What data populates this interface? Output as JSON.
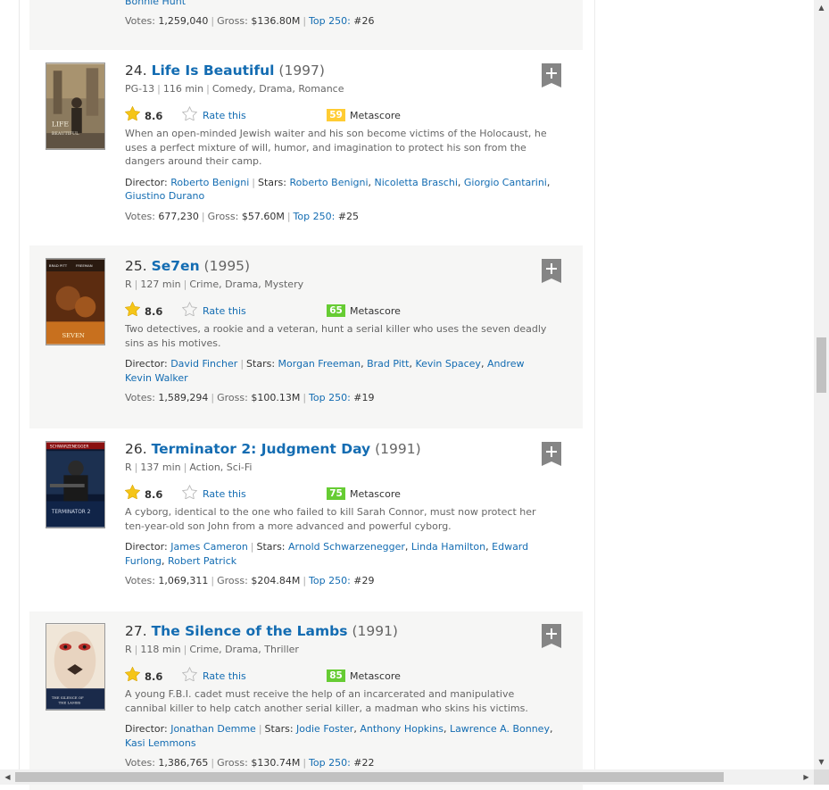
{
  "top_partial": {
    "credit_tail": "Bonnie Hunt",
    "votes_label": "Votes:",
    "votes": "1,259,040",
    "gross_label": "Gross:",
    "gross": "$136.80M",
    "top250_label": "Top 250:",
    "top250": "#26"
  },
  "movies": [
    {
      "index": "24.",
      "title": "Life Is Beautiful",
      "year": "(1997)",
      "certificate": "PG-13",
      "runtime": "116 min",
      "genres": "Comedy, Drama, Romance",
      "rating": "8.6",
      "rate_label": "Rate this",
      "metascore": "59",
      "metascore_color": "#ffcc33",
      "metascore_label": "Metascore",
      "description": "When an open-minded Jewish waiter and his son become victims of the Holocaust, he uses a perfect mixture of will, humor, and imagination to protect his son from the dangers around their camp.",
      "director_label": "Director:",
      "director": "Roberto Benigni",
      "stars_label": "Stars:",
      "stars": [
        "Roberto Benigni",
        "Nicoletta Braschi",
        "Giorgio Cantarini",
        "Giustino Durano"
      ],
      "votes_label": "Votes:",
      "votes": "677,230",
      "gross_label": "Gross:",
      "gross": "$57.60M",
      "top250_label": "Top 250:",
      "top250": "#25",
      "poster_label": "LIFE IS BEAUTIFUL"
    },
    {
      "index": "25.",
      "title": "Se7en",
      "year": "(1995)",
      "certificate": "R",
      "runtime": "127 min",
      "genres": "Crime, Drama, Mystery",
      "rating": "8.6",
      "rate_label": "Rate this",
      "metascore": "65",
      "metascore_color": "#66cc33",
      "metascore_label": "Metascore",
      "description": "Two detectives, a rookie and a veteran, hunt a serial killer who uses the seven deadly sins as his motives.",
      "director_label": "Director:",
      "director": "David Fincher",
      "stars_label": "Stars:",
      "stars": [
        "Morgan Freeman",
        "Brad Pitt",
        "Kevin Spacey",
        "Andrew Kevin Walker"
      ],
      "votes_label": "Votes:",
      "votes": "1,589,294",
      "gross_label": "Gross:",
      "gross": "$100.13M",
      "top250_label": "Top 250:",
      "top250": "#19",
      "poster_label": "SEVEN"
    },
    {
      "index": "26.",
      "title": "Terminator 2: Judgment Day",
      "year": "(1991)",
      "certificate": "R",
      "runtime": "137 min",
      "genres": "Action, Sci-Fi",
      "rating": "8.6",
      "rate_label": "Rate this",
      "metascore": "75",
      "metascore_color": "#66cc33",
      "metascore_label": "Metascore",
      "description": "A cyborg, identical to the one who failed to kill Sarah Connor, must now protect her ten-year-old son John from a more advanced and powerful cyborg.",
      "director_label": "Director:",
      "director": "James Cameron",
      "stars_label": "Stars:",
      "stars": [
        "Arnold Schwarzenegger",
        "Linda Hamilton",
        "Edward Furlong",
        "Robert Patrick"
      ],
      "votes_label": "Votes:",
      "votes": "1,069,311",
      "gross_label": "Gross:",
      "gross": "$204.84M",
      "top250_label": "Top 250:",
      "top250": "#29",
      "poster_label": "TERMINATOR 2"
    },
    {
      "index": "27.",
      "title": "The Silence of the Lambs",
      "year": "(1991)",
      "certificate": "R",
      "runtime": "118 min",
      "genres": "Crime, Drama, Thriller",
      "rating": "8.6",
      "rate_label": "Rate this",
      "metascore": "85",
      "metascore_color": "#66cc33",
      "metascore_label": "Metascore",
      "description": "A young F.B.I. cadet must receive the help of an incarcerated and manipulative cannibal killer to help catch another serial killer, a madman who skins his victims.",
      "director_label": "Director:",
      "director": "Jonathan Demme",
      "stars_label": "Stars:",
      "stars": [
        "Jodie Foster",
        "Anthony Hopkins",
        "Lawrence A. Bonney",
        "Kasi Lemmons"
      ],
      "votes_label": "Votes:",
      "votes": "1,386,765",
      "gross_label": "Gross:",
      "gross": "$130.74M",
      "top250_label": "Top 250:",
      "top250": "#22",
      "poster_label": "THE SILENCE OF THE LAMBS"
    }
  ]
}
